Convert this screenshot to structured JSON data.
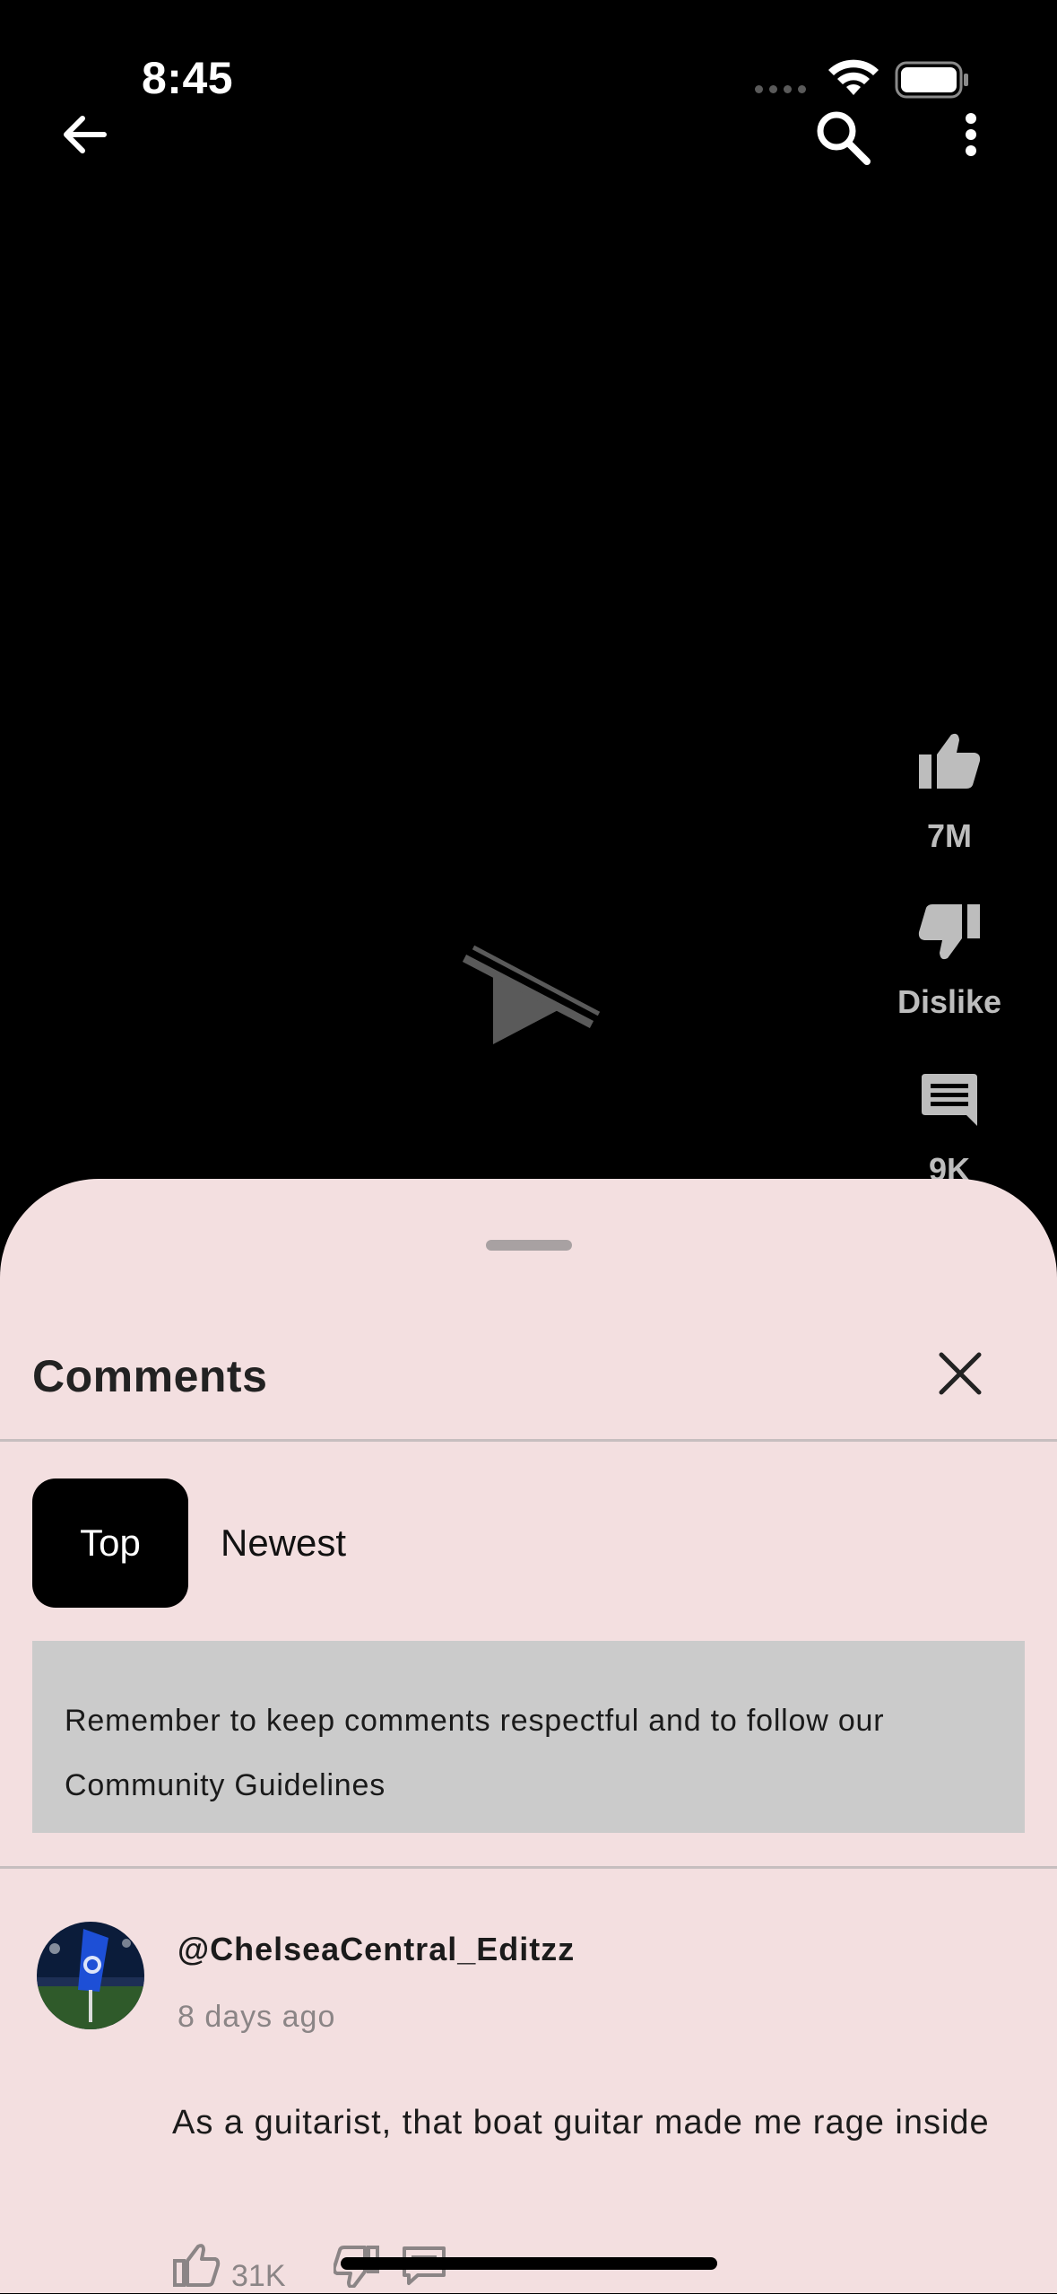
{
  "status_bar": {
    "time": "8:45"
  },
  "actions": {
    "like_count": "7M",
    "dislike_label": "Dislike",
    "comment_count_partial": "9K"
  },
  "sheet": {
    "title": "Comments",
    "tabs": [
      {
        "label": "Top",
        "selected": true
      },
      {
        "label": "Newest",
        "selected": false
      }
    ],
    "notice": "Remember to keep comments respectful and to follow our Community Guidelines",
    "comments": [
      {
        "author": "@ChelseaCentral_Editzz",
        "time": "8 days ago",
        "text": "As a guitarist, that boat guitar made me rage inside",
        "likes": "31K"
      }
    ]
  },
  "colors": {
    "sheet_bg": "#f3dfe0",
    "video_bg": "#000000",
    "notice_bg": "#cbcbcb",
    "action_gray": "#bdbdbd"
  }
}
